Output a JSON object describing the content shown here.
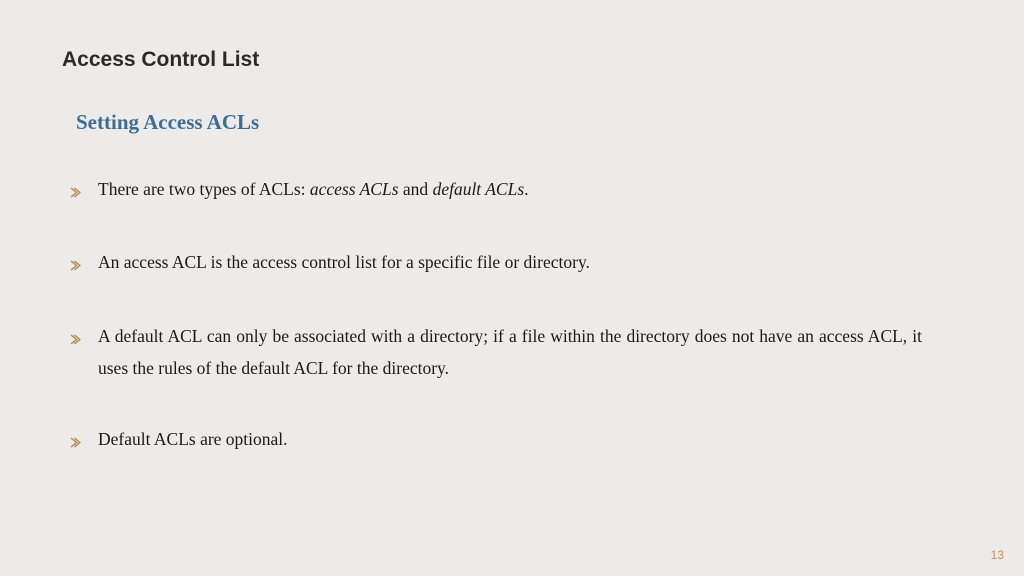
{
  "title": "Access Control List",
  "subtitle": "Setting Access ACLs",
  "bullets": {
    "b0_prefix": "There are two types of ACLs: ",
    "b0_it1": "access ACLs",
    "b0_mid": " and ",
    "b0_it2": "default ACLs",
    "b0_suffix": ".",
    "b1": "An access ACL is the access control list for a specific file or directory.",
    "b2": "A default ACL can only be associated with a directory; if a file within the directory does not have an access ACL, it uses the rules of the default ACL for the directory.",
    "b3": "Default ACLs are optional."
  },
  "page_number": "13"
}
